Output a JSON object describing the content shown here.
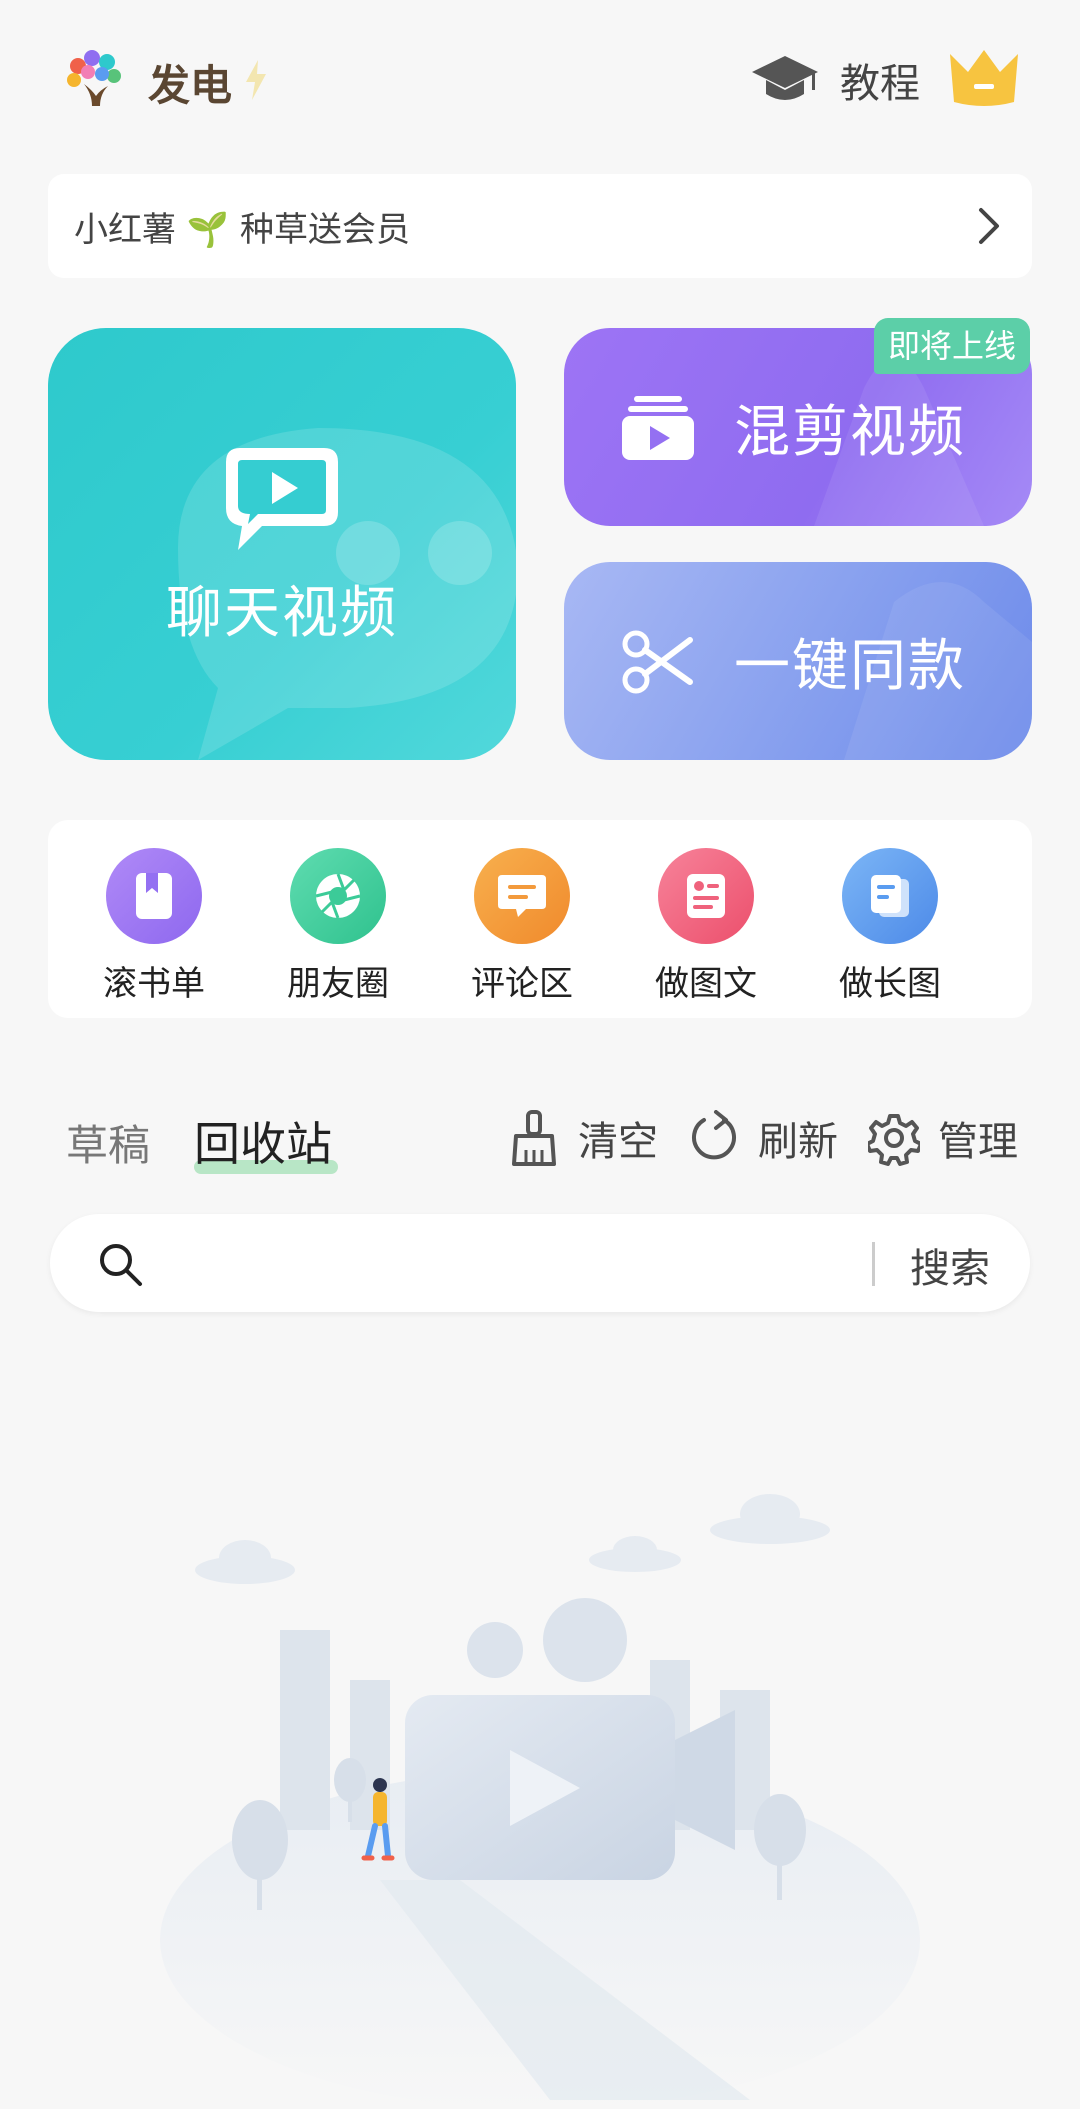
{
  "header": {
    "app_name": "发电",
    "tutorial_label": "教程"
  },
  "banner": {
    "text": "小红薯 🌱 种草送会员"
  },
  "cards": {
    "chat_video": "聊天视频",
    "mix_video": "混剪视频",
    "one_click_same": "一键同款",
    "coming_soon_badge": "即将上线"
  },
  "tools": [
    {
      "label": "滚书单",
      "color": "#9b74f3"
    },
    {
      "label": "朋友圈",
      "color": "#3fd0a0"
    },
    {
      "label": "评论区",
      "color": "#f59a3c"
    },
    {
      "label": "做图文",
      "color": "#f0617a"
    },
    {
      "label": "做长图",
      "color": "#5a9cf0"
    }
  ],
  "tabs": {
    "draft": "草稿",
    "recycle": "回收站"
  },
  "actions": {
    "clear": "清空",
    "refresh": "刷新",
    "manage": "管理"
  },
  "search": {
    "placeholder": "",
    "button": "搜索"
  },
  "colors": {
    "accent_green": "#b8e6c6",
    "crown": "#f7c440"
  }
}
